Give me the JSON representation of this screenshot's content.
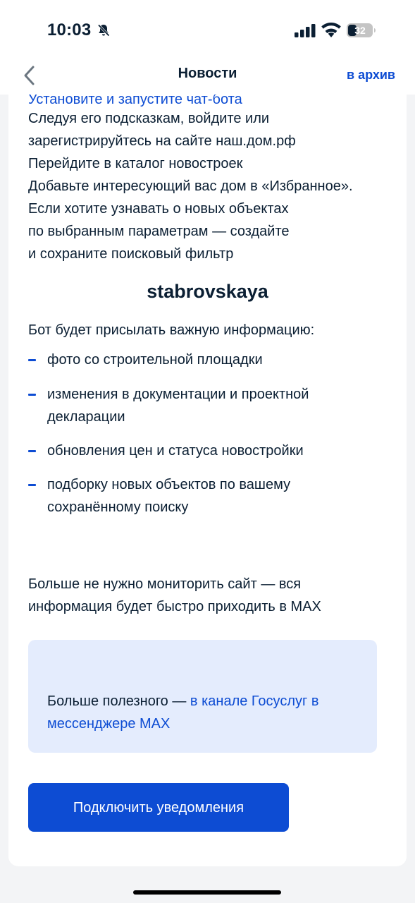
{
  "status_bar": {
    "time": "10:03",
    "battery_level": "32",
    "icons": [
      "bell-off-icon",
      "signal-icon",
      "wifi-icon",
      "battery-icon"
    ]
  },
  "nav": {
    "title": "Новости",
    "archive_label": "в архив",
    "back_icon": "chevron-left-icon"
  },
  "content": {
    "cut_line": "Установите и запустите чат-бота",
    "steps": [
      "Следуя его подсказкам, войдите или",
      "зарегистрируйтесь на сайте наш.дом.рф",
      "Перейдите в каталог новостроек",
      "Добавьте интересующий вас дом в «Избранное».",
      "Если хотите узнавать о новых объектах",
      "по выбранным параметрам — создайте",
      "и сохраните поисковый фильтр"
    ],
    "bot_name": "stabrovskaya",
    "intro": "Бот будет присылать важную информацию:",
    "bullets": [
      "фото со строительной площадки",
      "изменения в документации и проектной декларации",
      "обновления цен и статуса новостройки",
      "подборку новых объектов по вашему сохранённому поиску"
    ],
    "summary": "Больше не нужно мониторить сайт — вся информация будет быстро приходить в MAX",
    "info_box": {
      "prefix": "Больше полезного — ",
      "link": "в канале Госуслуг в мессенджере MAX"
    },
    "button_label": "Подключить уведомления"
  },
  "colors": {
    "accent": "#0d4cd3",
    "text": "#0b1f33",
    "info_background": "#e4ecfd",
    "page_background": "#f3f4f6"
  }
}
